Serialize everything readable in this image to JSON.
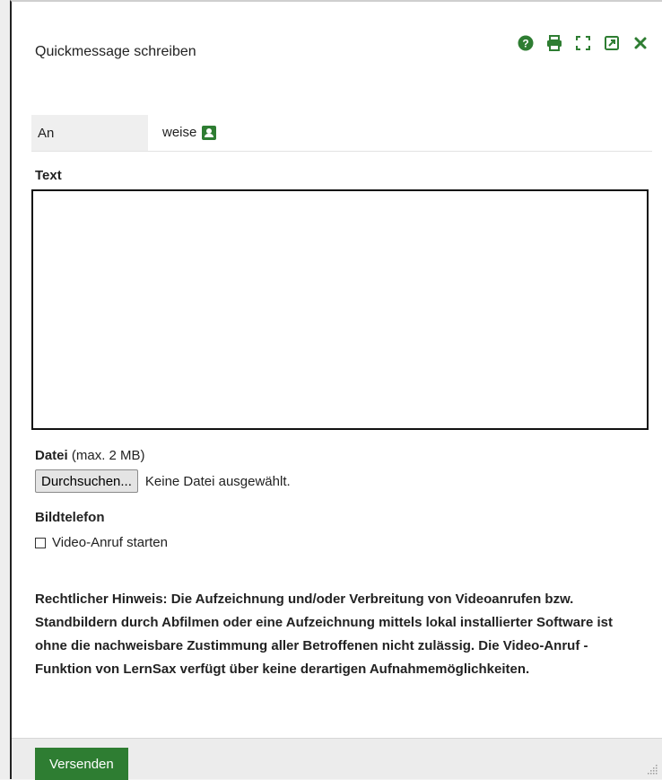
{
  "dialog": {
    "title": "Quickmessage schreiben",
    "tools": [
      "help-icon",
      "print-icon",
      "fullscreen-icon",
      "popout-icon",
      "close-icon"
    ]
  },
  "recipient": {
    "label": "An",
    "value": "weise"
  },
  "text": {
    "label": "Text",
    "value": ""
  },
  "file": {
    "label": "Datei",
    "limit": "(max. 2 MB)",
    "button_label": "Durchsuchen...",
    "status": "Keine Datei ausgewählt."
  },
  "video": {
    "label": "Bildtelefon",
    "checkbox_label": "Video-Anruf starten",
    "checked": false
  },
  "notice": "Rechtlicher Hinweis: Die Aufzeichnung und/oder Verbreitung von Videoanrufen bzw. Standbildern durch Abfilmen oder eine Aufzeichnung mittels lokal installierter Software ist ohne die nachweisbare Zustimmung aller Betroffenen nicht zulässig. Die Video-Anruf - Funktion von LernSax verfügt über keine derartigen Aufnahmemöglichkeiten.",
  "footer": {
    "send_label": "Versenden"
  },
  "colors": {
    "accent": "#2e7d32",
    "text": "#222222"
  }
}
